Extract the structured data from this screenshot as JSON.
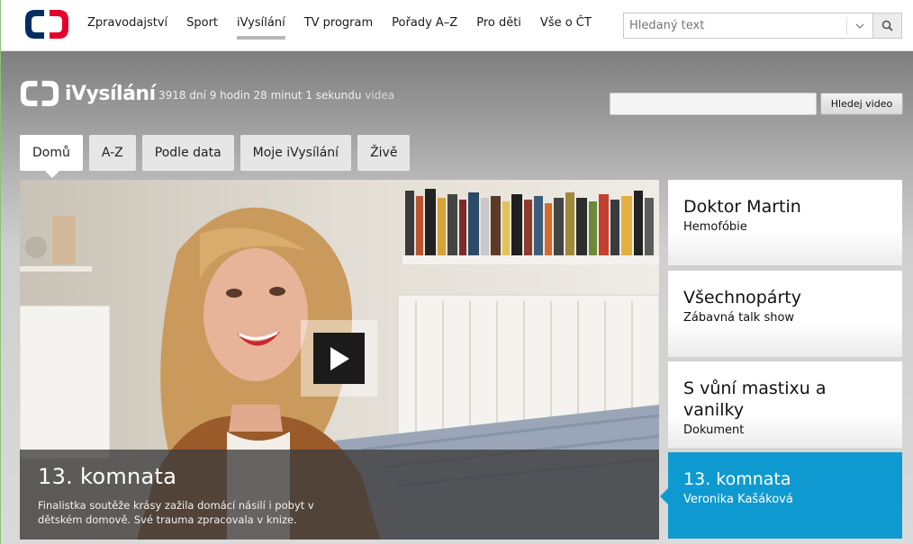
{
  "topnav": {
    "items": [
      "Zpravodajství",
      "Sport",
      "iVysílání",
      "TV program",
      "Pořady A–Z",
      "Pro děti",
      "Vše o ČT"
    ],
    "active_index": 2
  },
  "top_search": {
    "placeholder": "Hledaný text"
  },
  "header": {
    "brand": "iVysílání",
    "counter": "3918 dní 9 hodin 28 minut 1 sekundu",
    "counter_link": "videa",
    "search_button": "Hledej video"
  },
  "tabs": [
    "Domů",
    "A-Z",
    "Podle data",
    "Moje iVysílání",
    "Živě"
  ],
  "feature": {
    "title": "13. komnata",
    "description": "Finalistka soutěže krásy zažila domácí násilí i pobyt v dětském domově. Své trauma zpracovala v knize."
  },
  "side_items": [
    {
      "title": "Doktor Martin",
      "subtitle": "Hemofóbie"
    },
    {
      "title": "Všechnopárty",
      "subtitle": "Zábavná talk show"
    },
    {
      "title": "S vůní mastixu a vanilky",
      "subtitle": "Dokument"
    },
    {
      "title": "13. komnata",
      "subtitle": "Veronika Kašáková"
    }
  ],
  "colors": {
    "accent": "#0e9ad0",
    "ct_red": "#e4002b",
    "ct_blue": "#002d62"
  }
}
